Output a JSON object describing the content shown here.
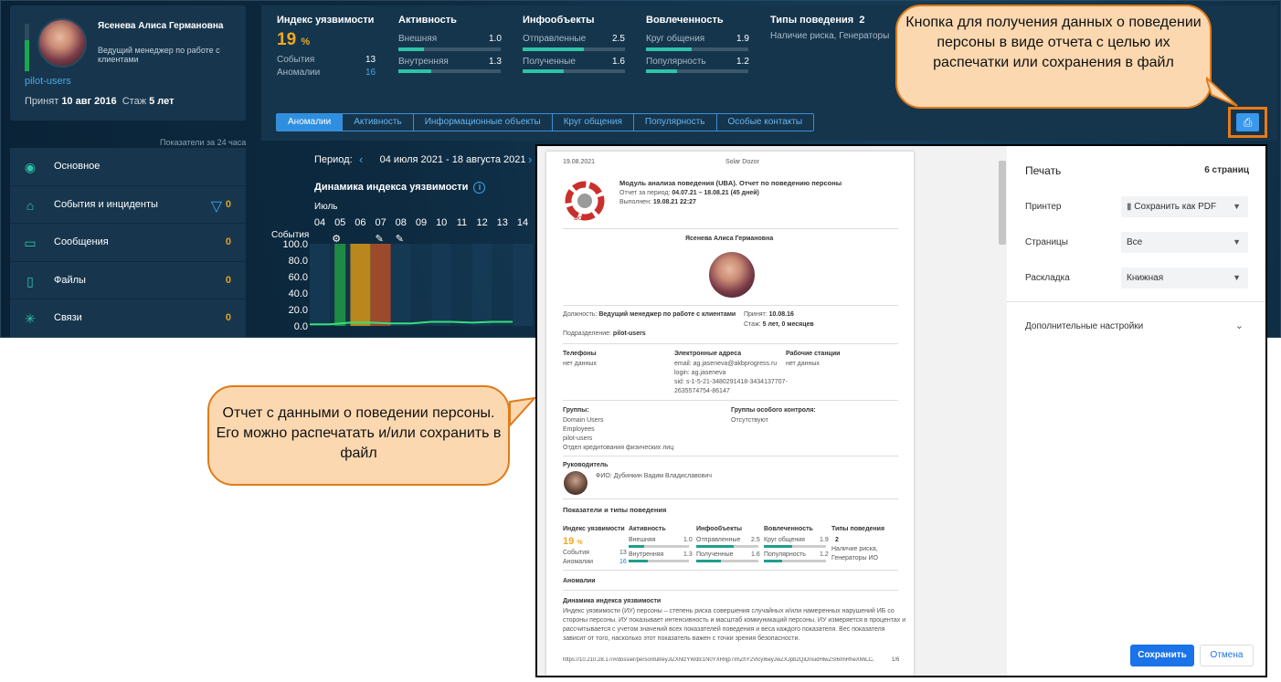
{
  "person": {
    "name": "Ясенева Алиса Германовна",
    "position": "Ведущий менеджер по работе с клиентами",
    "group": "pilot-users",
    "hired_label": "Принят",
    "hired": "10 авг 2016",
    "tenure_label": "Стаж",
    "tenure": "5 лет"
  },
  "indicators_caption": "Показатели за 24 часа",
  "nav": [
    {
      "label": "Основное",
      "count": "",
      "icon": "person-icon"
    },
    {
      "label": "События и инциденты",
      "count": "0",
      "icon": "building-icon",
      "filter": true
    },
    {
      "label": "Сообщения",
      "count": "0",
      "icon": "chat-icon"
    },
    {
      "label": "Файлы",
      "count": "0",
      "icon": "file-icon"
    },
    {
      "label": "Связи",
      "count": "0",
      "icon": "network-icon"
    }
  ],
  "metrics": {
    "vuln": {
      "title": "Индекс уязвимости",
      "value": "19",
      "unit": "%",
      "events_label": "События",
      "events": "13",
      "anom_label": "Аномалии",
      "anom": "16"
    },
    "activity": {
      "title": "Активность",
      "r1": "Внешняя",
      "v1": "1.0",
      "r2": "Внутренняя",
      "v2": "1.3"
    },
    "info": {
      "title": "Инфообъекты",
      "r1": "Отправленные",
      "v1": "2.5",
      "r2": "Полученные",
      "v2": "1.6"
    },
    "engage": {
      "title": "Вовлеченность",
      "r1": "Круг общения",
      "v1": "1.9",
      "r2": "Популярность",
      "v2": "1.2"
    },
    "types": {
      "title": "Типы поведения",
      "count": "2",
      "text": "Наличие риска, Генераторы"
    }
  },
  "tabs": [
    "Аномалии",
    "Активность",
    "Информационные объекты",
    "Круг общения",
    "Популярность",
    "Особые контакты"
  ],
  "period": {
    "label": "Период:",
    "value": "04 июля 2021 - 18 августа 2021"
  },
  "chart_data": {
    "type": "bar",
    "title": "Динамика индекса уязвимости",
    "month": "Июль",
    "categories": [
      "04",
      "05",
      "06",
      "07",
      "08",
      "09",
      "10",
      "11",
      "12",
      "13",
      "14"
    ],
    "ylabel": "События",
    "yticks": [
      "100.0",
      "80.0",
      "60.0",
      "40.0",
      "20.0",
      "0.0"
    ],
    "ylim": [
      0,
      100
    ],
    "bars": [
      {
        "cat": "05",
        "value": 100,
        "color": "#1f8a45"
      },
      {
        "cat": "06",
        "value": 100,
        "color": "#b9871e"
      },
      {
        "cat": "07",
        "value": 100,
        "color": "#9c4a2c"
      }
    ],
    "line": [
      2,
      2,
      4,
      4,
      3,
      3,
      5,
      5,
      4,
      5,
      5
    ]
  },
  "callout1": "Кнопка для получения данных о поведении персоны в виде отчета с целью их распечатки или сохранения в файл",
  "callout2": "Отчет с данными о поведении персоны. Его можно распечатать и/или сохранить в файл",
  "report": {
    "date": "19.08.2021",
    "product": "Solar Dozor",
    "heading": "Модуль анализа поведения (UBA). Отчет по поведению персоны",
    "period_label": "Отчет за период:",
    "period": "04.07.21 – 18.08.21 (45 дней)",
    "done_label": "Выполнен:",
    "done": "19.08.21 22:27",
    "logo": "Dozor",
    "person": "Ясенева Алиса Германовна",
    "pos_label": "Должность:",
    "pos": "Ведущий менеджер по работе с клиентами",
    "dept_label": "Подразделение:",
    "dept": "pilot-users",
    "hired_label": "Принят:",
    "hired": "10.08.16",
    "tenure_label": "Стаж:",
    "tenure": "5 лет, 0 месяцев",
    "phones_t": "Телефоны",
    "phones": "нет данных",
    "emails_t": "Электронные адреса",
    "email": "email: ag.jaseneva@akbprogress.ru",
    "login": "login: ag.jaseneva",
    "sid": "sid: s-1-5-21-3480291418-3434137707-",
    "sid2": "2635574754-86147",
    "ws_t": "Рабочие станции",
    "ws": "нет данных",
    "groups_t": "Группы:",
    "groups": [
      "Domain Users",
      "Employees",
      "pilot-users",
      "Отдел кредитования физических лиц"
    ],
    "special_t": "Группы особого контроля:",
    "special": "Отсутствуют",
    "manager_t": "Руководитель",
    "manager": "ФИО: Дубинкин Вадим Владиславович",
    "indicators_t": "Показатели и типы поведения",
    "vuln_t": "Индекс уязвимости",
    "vuln": "19",
    "unit": "%",
    "events_l": "События",
    "events": "13",
    "anom_l": "Аномалии",
    "anom": "16",
    "act_t": "Активность",
    "act1": "Внешняя",
    "act1v": "1.0",
    "act2": "Внутренняя",
    "act2v": "1.3",
    "inf_t": "Инфообъекты",
    "inf1": "Отправленные",
    "inf1v": "2.5",
    "inf2": "Полученные",
    "inf2v": "1.6",
    "eng_t": "Вовлеченность",
    "eng1": "Круг общения",
    "eng1v": "1.9",
    "eng2": "Популярность",
    "eng2v": "1.2",
    "typ_t": "Типы поведения",
    "typ": "2",
    "typ1": "Наличие риска,",
    "typ2": "Генераторы ИО",
    "anom_section": "Аномалии",
    "dyn_t": "Динамика индекса уязвимости",
    "dyn1": "Индекс уязвимости (ИУ) персоны – степень риска совершения случайных и/или намеренных нарушений ИБ со",
    "dyn2": "стороны персоны. ИУ показывает интенсивность и масштаб коммуникаций персоны. ИУ измеряется в процентах и",
    "dyn3": "рассчитывается с учетом значений всех показателей поведения и веса каждого показателя. Вес показателя",
    "dyn4": "зависит от того, насколько этот показатель важен с точки зрения безопасности.",
    "url": "https://10.210.28.17/#/dossier/personfull/eyJlZXNlzYWdlc1N0YXRlIjp7ImZhY2VlcyI6eyJwZXJpb2QiOnsidHlwZSI6ImRheXMiLCJ2YWx1ZSI6NDV9fX19",
    "pageno": "1/6"
  },
  "print": {
    "title": "Печать",
    "pages": "6 страниц",
    "printer_l": "Принтер",
    "printer": "Сохранить как PDF",
    "pages_l": "Страницы",
    "pages_v": "Все",
    "layout_l": "Раскладка",
    "layout": "Книжная",
    "more": "Дополнительные настройки",
    "save": "Сохранить",
    "cancel": "Отмена"
  }
}
